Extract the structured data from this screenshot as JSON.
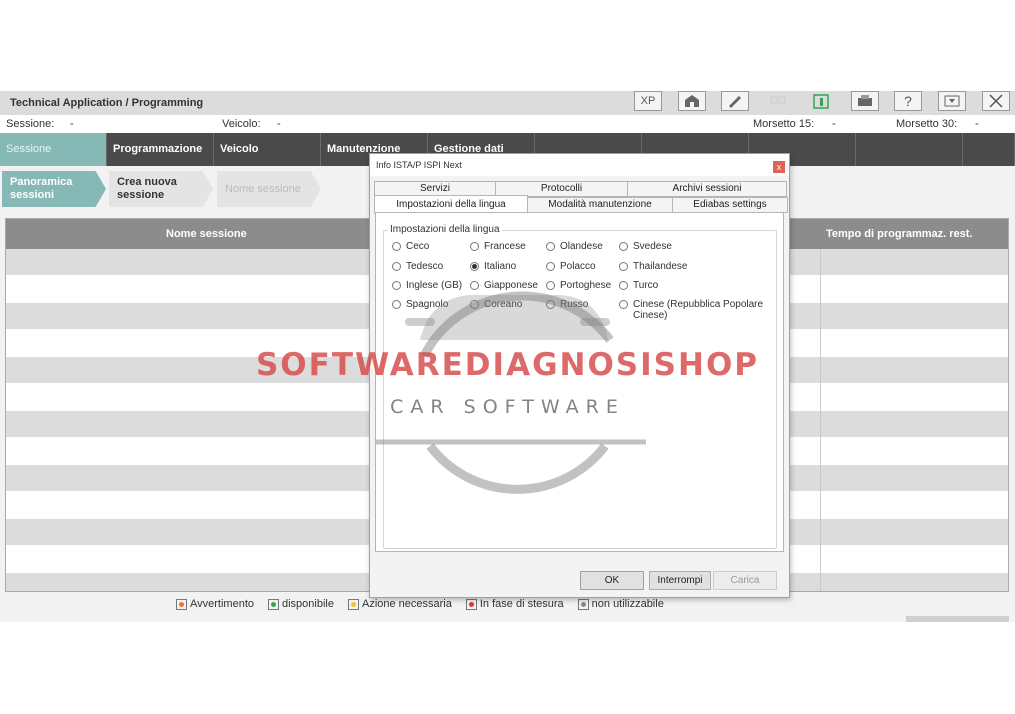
{
  "app": {
    "title": "Technical Application / Programming",
    "toolbar": [
      "xp-icon",
      "home-icon",
      "edit-icon",
      "grid-icon",
      "battery-icon",
      "printer-icon",
      "help-icon",
      "download-icon",
      "close-icon"
    ],
    "toolbar_xp_label": "XP",
    "toolbar_help_label": "?"
  },
  "status": {
    "session_label": "Sessione:",
    "session_value": "-",
    "vehicle_label": "Veicolo:",
    "vehicle_value": "-",
    "clamp15_label": "Morsetto 15:",
    "clamp15_value": "-",
    "clamp30_label": "Morsetto 30:",
    "clamp30_value": "-"
  },
  "nav": {
    "items": [
      "Sessione",
      "Programmazione",
      "Veicolo",
      "Manutenzione",
      "Gestione dati",
      "",
      "",
      "",
      "",
      ""
    ]
  },
  "subtabs": {
    "overview": "Panoramica sessioni",
    "create": "Crea nuova sessione",
    "name": "Nome sessione"
  },
  "table": {
    "columns": [
      "Nome sessione",
      "Tempo di programmaz. rest."
    ],
    "row_count": 13
  },
  "legend": [
    {
      "label": "Avvertimento",
      "color": "#e8742f"
    },
    {
      "label": "disponibile",
      "color": "#2fa84f"
    },
    {
      "label": "Azione necessaria",
      "color": "#f2c230"
    },
    {
      "label": "In fase di stesura",
      "color": "#d63a3a"
    },
    {
      "label": "non utilizzabile",
      "color": "#8a8a8a"
    }
  ],
  "dialog": {
    "title": "Info ISTA/P ISPI Next",
    "close_label": "x",
    "tabs_row1": [
      "Servizi",
      "Protocolli",
      "Archivi sessioni"
    ],
    "tabs_row2": [
      "Impostazioni della lingua",
      "Modalità manutenzione",
      "Ediabas settings"
    ],
    "group_title": "Impostazioni della lingua",
    "languages": [
      {
        "label": "Ceco",
        "selected": false
      },
      {
        "label": "Francese",
        "selected": false
      },
      {
        "label": "Olandese",
        "selected": false
      },
      {
        "label": "Svedese",
        "selected": false
      },
      {
        "label": "Tedesco",
        "selected": false
      },
      {
        "label": "Italiano",
        "selected": true
      },
      {
        "label": "Polacco",
        "selected": false
      },
      {
        "label": "Thailandese",
        "selected": false
      },
      {
        "label": "Inglese (GB)",
        "selected": false
      },
      {
        "label": "Giapponese",
        "selected": false
      },
      {
        "label": "Portoghese",
        "selected": false
      },
      {
        "label": "Turco",
        "selected": false
      },
      {
        "label": "Spagnolo",
        "selected": false
      },
      {
        "label": "Coreano",
        "selected": false
      },
      {
        "label": "Russo",
        "selected": false
      },
      {
        "label": "Cinese (Repubblica Popolare Cinese)",
        "selected": false
      }
    ],
    "ok_label": "OK",
    "cancel_label": "Interrompi",
    "load_label": "Carica"
  },
  "watermark": {
    "main": "SOFTWAREDIAGNOSISHOP",
    "sub": "CAR SOFTWARE"
  },
  "colors": {
    "accent": "#86b8b6",
    "nav_bg": "#4a4a4a",
    "table_head": "#8c8c8c",
    "watermark_red": "#d64848"
  }
}
